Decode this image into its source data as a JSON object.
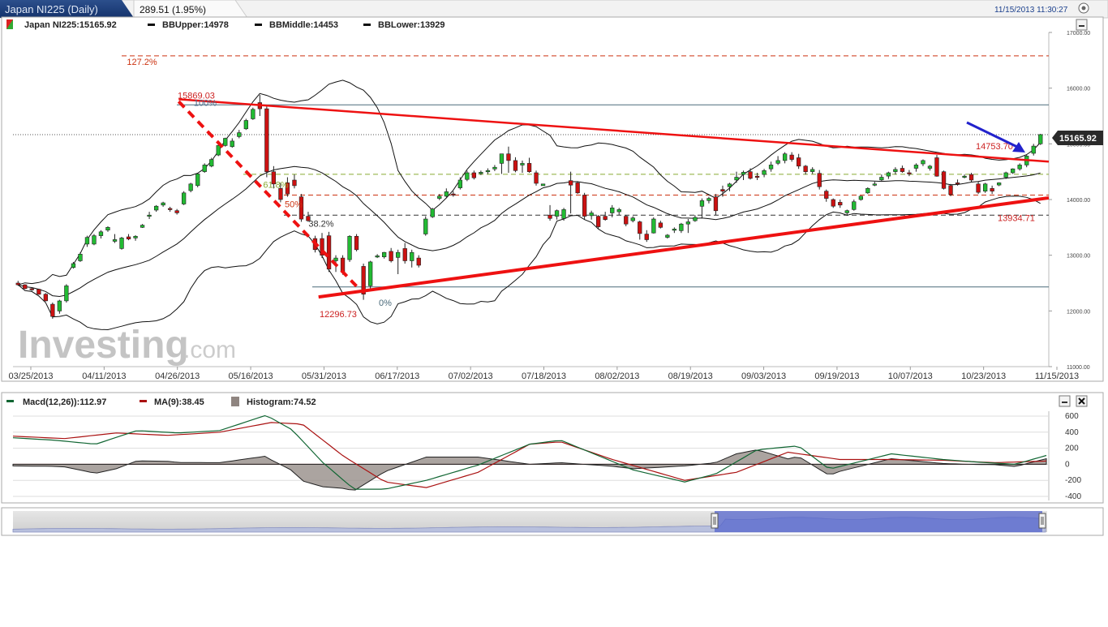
{
  "header": {
    "tab_title": "Japan NI225 (Daily)",
    "change": "289.51 (1.95%)",
    "timestamp": "11/15/2013 11:30:27"
  },
  "legend": {
    "instrument": "Japan NI225:15165.92",
    "bb_upper": "BBUpper:14978",
    "bb_middle": "BBMiddle:14453",
    "bb_lower": "BBLower:13929"
  },
  "watermark": {
    "brand": "Investing",
    "suffix": ".com"
  },
  "macd_legend": {
    "macd": "Macd(12,26)):112.97",
    "ma": "MA(9):38.45",
    "histogram": "Histogram:74.52"
  },
  "colors": {
    "up": "#22bb33",
    "down": "#cc1111",
    "trendline": "#ee1111",
    "fib_line": "#cc3311",
    "arrow": "#2222cc",
    "navigator_fill": "#5566cc",
    "macd_line": "#116633",
    "ma_line": "#aa1111",
    "hist_fill": "#8f8580"
  },
  "chart_data": [
    {
      "type": "candlestick",
      "title": "Japan NI225 (Daily)",
      "x_ticks": [
        "03/25/2013",
        "04/11/2013",
        "04/26/2013",
        "05/16/2013",
        "05/31/2013",
        "06/17/2013",
        "07/02/2013",
        "07/18/2013",
        "08/02/2013",
        "08/19/2013",
        "09/03/2013",
        "09/19/2013",
        "10/07/2013",
        "10/23/2013",
        "11/15/2013"
      ],
      "y_ticks": [
        "17000.00",
        "16000.00",
        "15000.00",
        "14000.00",
        "13000.00",
        "12000.00",
        "11000.00"
      ],
      "ylim": [
        11000,
        17000
      ],
      "last_price_label": "15165.92",
      "annotations": [
        {
          "text": "127.2%",
          "value": 16580
        },
        {
          "text": "15869.03",
          "value": 15869.03
        },
        {
          "text": "100%",
          "value": 15869.03
        },
        {
          "text": "61.8%",
          "value": 14400
        },
        {
          "text": "50%",
          "value": 14050
        },
        {
          "text": "38.2%",
          "value": 13700
        },
        {
          "text": "0%",
          "value": 12296.73
        },
        {
          "text": "12296.73",
          "value": 12296.73
        },
        {
          "text": "14753.70",
          "value": 14753.7
        },
        {
          "text": "13934.71",
          "value": 13934.71
        }
      ],
      "levels": [
        {
          "value": 16580,
          "style": "dashed",
          "color": "#cc3311"
        },
        {
          "value": 15700,
          "style": "solid",
          "color": "#4a6a7a"
        },
        {
          "value": 15165.92,
          "style": "dotted",
          "color": "#555555"
        },
        {
          "value": 14453,
          "style": "dashed",
          "color": "#88aa33"
        },
        {
          "value": 14080,
          "style": "dashed",
          "color": "#cc3311"
        },
        {
          "value": 13720,
          "style": "dashed",
          "color": "#333333"
        },
        {
          "value": 12430,
          "style": "solid",
          "color": "#4a6a7a"
        }
      ],
      "trendlines": [
        {
          "name": "upper",
          "from": [
            0.16,
            15800
          ],
          "to": [
            1.0,
            14680
          ]
        },
        {
          "name": "lower",
          "from": [
            0.295,
            12250
          ],
          "to": [
            1.0,
            14030
          ]
        },
        {
          "name": "retrace",
          "from": [
            0.16,
            15760
          ],
          "to": [
            0.335,
            12380
          ]
        }
      ],
      "candles": [
        [
          12500,
          12540,
          12450,
          12470
        ],
        [
          12470,
          12480,
          12390,
          12400
        ],
        [
          12400,
          12420,
          12360,
          12390
        ],
        [
          12390,
          12400,
          12290,
          12300
        ],
        [
          12300,
          12320,
          12170,
          12180
        ],
        [
          12120,
          12150,
          11860,
          11900
        ],
        [
          12000,
          12200,
          11950,
          12180
        ],
        [
          12180,
          12480,
          12150,
          12450
        ],
        [
          12780,
          12880,
          12760,
          12850
        ],
        [
          12900,
          13050,
          12880,
          13020
        ],
        [
          13200,
          13350,
          13150,
          13320
        ],
        [
          13200,
          13380,
          13180,
          13350
        ],
        [
          13350,
          13450,
          13300,
          13420
        ],
        [
          13450,
          13520,
          13420,
          13500
        ],
        [
          13250,
          13380,
          13220,
          13280
        ],
        [
          13120,
          13330,
          13100,
          13310
        ],
        [
          13330,
          13380,
          13270,
          13290
        ],
        [
          13310,
          13360,
          13260,
          13340
        ],
        [
          13500,
          13560,
          13490,
          13540
        ],
        [
          13700,
          13780,
          13650,
          13720
        ],
        [
          13810,
          13900,
          13780,
          13880
        ],
        [
          13900,
          13960,
          13870,
          13940
        ],
        [
          13840,
          13870,
          13780,
          13820
        ],
        [
          13800,
          13830,
          13730,
          13760
        ],
        [
          13920,
          14150,
          13900,
          14120
        ],
        [
          14160,
          14300,
          14130,
          14280
        ],
        [
          14250,
          14480,
          14220,
          14460
        ],
        [
          14500,
          14650,
          14480,
          14620
        ],
        [
          14600,
          14750,
          14580,
          14720
        ],
        [
          14800,
          15000,
          14780,
          14970
        ],
        [
          14970,
          15110,
          14950,
          15100
        ],
        [
          14950,
          15100,
          14930,
          15050
        ],
        [
          15130,
          15250,
          15100,
          15200
        ],
        [
          15270,
          15450,
          15250,
          15420
        ],
        [
          15450,
          15650,
          15430,
          15620
        ],
        [
          15740,
          15880,
          15500,
          15630
        ],
        [
          15630,
          15700,
          14400,
          14500
        ],
        [
          14500,
          14600,
          14200,
          14280
        ],
        [
          14200,
          14300,
          13950,
          14000
        ],
        [
          14300,
          14400,
          14050,
          14100
        ],
        [
          14350,
          14450,
          14200,
          14250
        ],
        [
          14050,
          14100,
          13600,
          13650
        ],
        [
          13700,
          13780,
          13600,
          13620
        ],
        [
          13300,
          13350,
          13050,
          13100
        ],
        [
          13300,
          13400,
          12950,
          13000
        ],
        [
          13350,
          13420,
          12700,
          12750
        ],
        [
          12900,
          13000,
          12700,
          12950
        ],
        [
          12950,
          13000,
          12650,
          12700
        ],
        [
          12920,
          13360,
          12880,
          13340
        ],
        [
          13340,
          13380,
          13070,
          13100
        ],
        [
          12800,
          12850,
          12200,
          12300
        ],
        [
          12450,
          12900,
          12400,
          12880
        ],
        [
          12980,
          13020,
          12950,
          12990
        ],
        [
          12970,
          13060,
          12940,
          13050
        ],
        [
          13070,
          13130,
          12870,
          12900
        ],
        [
          12960,
          13100,
          12660,
          13050
        ],
        [
          13120,
          13220,
          12850,
          12900
        ],
        [
          12900,
          13100,
          12780,
          13050
        ],
        [
          12950,
          13000,
          12780,
          12820
        ],
        [
          13380,
          13700,
          13350,
          13650
        ],
        [
          13690,
          13850,
          13670,
          13830
        ],
        [
          14020,
          14100,
          13990,
          14060
        ],
        [
          14060,
          14200,
          14040,
          14140
        ],
        [
          14100,
          14150,
          14050,
          14080
        ],
        [
          14210,
          14400,
          14180,
          14350
        ],
        [
          14360,
          14520,
          14330,
          14480
        ],
        [
          14480,
          14520,
          14360,
          14390
        ],
        [
          14470,
          14520,
          14440,
          14490
        ],
        [
          14500,
          14560,
          14460,
          14520
        ],
        [
          14550,
          14620,
          14510,
          14580
        ],
        [
          14650,
          14750,
          14460,
          14820
        ],
        [
          14820,
          14950,
          14480,
          14700
        ],
        [
          14700,
          14760,
          14490,
          14520
        ],
        [
          14620,
          14700,
          14480,
          14650
        ],
        [
          14650,
          14750,
          14480,
          14500
        ],
        [
          14480,
          14520,
          14250,
          14290
        ],
        [
          14250,
          14280,
          14250,
          14280
        ],
        [
          13720,
          13900,
          13620,
          13660
        ],
        [
          13700,
          13820,
          13640,
          13800
        ],
        [
          13660,
          13850,
          13620,
          13820
        ],
        [
          14340,
          14500,
          13750,
          14260
        ],
        [
          14300,
          14320,
          14100,
          14120
        ],
        [
          14080,
          14120,
          13640,
          13700
        ],
        [
          13710,
          13800,
          13640,
          13760
        ],
        [
          13700,
          13720,
          13480,
          13510
        ],
        [
          13700,
          13780,
          13620,
          13640
        ],
        [
          13760,
          13900,
          13680,
          13850
        ],
        [
          13780,
          13850,
          13720,
          13820
        ],
        [
          13700,
          13720,
          13520,
          13560
        ],
        [
          13620,
          13700,
          13590,
          13670
        ],
        [
          13600,
          13620,
          13280,
          13390
        ],
        [
          13380,
          13450,
          13240,
          13280
        ],
        [
          13400,
          13680,
          13390,
          13650
        ],
        [
          13580,
          13620,
          13480,
          13500
        ],
        [
          13320,
          13380,
          13300,
          13360
        ],
        [
          13450,
          13500,
          13400,
          13470
        ],
        [
          13440,
          13580,
          13400,
          13560
        ],
        [
          13560,
          13650,
          13400,
          13600
        ],
        [
          13620,
          13720,
          13600,
          13680
        ],
        [
          13880,
          14020,
          13660,
          13980
        ],
        [
          13980,
          14050,
          13930,
          14020
        ],
        [
          14050,
          14100,
          13720,
          13800
        ],
        [
          14180,
          14250,
          14050,
          14150
        ],
        [
          14230,
          14300,
          14150,
          14280
        ],
        [
          14350,
          14500,
          14300,
          14400
        ],
        [
          14450,
          14520,
          14350,
          14490
        ],
        [
          14500,
          14560,
          14360,
          14380
        ],
        [
          14420,
          14480,
          14350,
          14400
        ],
        [
          14450,
          14550,
          14400,
          14520
        ],
        [
          14550,
          14680,
          14500,
          14620
        ],
        [
          14650,
          14780,
          14620,
          14700
        ],
        [
          14700,
          14850,
          14650,
          14820
        ],
        [
          14800,
          14850,
          14680,
          14720
        ],
        [
          14750,
          14820,
          14550,
          14600
        ],
        [
          14600,
          14620,
          14450,
          14500
        ],
        [
          14500,
          14580,
          14460,
          14540
        ],
        [
          14470,
          14530,
          14180,
          14230
        ],
        [
          14150,
          14180,
          13960,
          14020
        ],
        [
          14000,
          14020,
          13850,
          13880
        ],
        [
          13950,
          14000,
          13850,
          13900
        ],
        [
          13760,
          13820,
          13720,
          13800
        ],
        [
          13820,
          14000,
          13800,
          13960
        ],
        [
          14000,
          14070,
          13980,
          14060
        ],
        [
          14120,
          14220,
          14100,
          14200
        ],
        [
          14280,
          14320,
          14240,
          14280
        ],
        [
          14350,
          14450,
          14320,
          14400
        ],
        [
          14420,
          14500,
          14370,
          14480
        ],
        [
          14500,
          14580,
          14450,
          14540
        ],
        [
          14560,
          14610,
          14480,
          14500
        ],
        [
          14480,
          14530,
          14420,
          14460
        ],
        [
          14560,
          14650,
          14500,
          14620
        ],
        [
          14640,
          14720,
          14600,
          14700
        ],
        [
          14560,
          14620,
          14520,
          14600
        ],
        [
          14750,
          14800,
          14410,
          14420
        ],
        [
          14500,
          14520,
          14180,
          14200
        ],
        [
          14250,
          14280,
          14060,
          14090
        ],
        [
          14300,
          14360,
          14250,
          14280
        ],
        [
          14400,
          14450,
          14380,
          14420
        ],
        [
          14450,
          14480,
          14320,
          14350
        ],
        [
          14280,
          14320,
          14100,
          14130
        ],
        [
          14150,
          14300,
          14120,
          14280
        ],
        [
          14200,
          14250,
          14100,
          14150
        ],
        [
          14260,
          14310,
          14240,
          14300
        ],
        [
          14400,
          14500,
          14370,
          14480
        ],
        [
          14480,
          14560,
          14460,
          14550
        ],
        [
          14550,
          14650,
          14520,
          14620
        ],
        [
          14620,
          14800,
          14580,
          14780
        ],
        [
          14830,
          15000,
          14790,
          14960
        ],
        [
          15000,
          15180,
          14980,
          15165.92
        ]
      ]
    },
    {
      "type": "line+histogram",
      "title": "MACD",
      "y_ticks": [
        "600",
        "400",
        "200",
        "0",
        "-200",
        "-400"
      ],
      "ylim": [
        -430,
        640
      ],
      "series": [
        {
          "name": "Macd(12,26))",
          "x": [
            0,
            0.04,
            0.08,
            0.12,
            0.16,
            0.2,
            0.245,
            0.27,
            0.3,
            0.33,
            0.36,
            0.4,
            0.45,
            0.5,
            0.53,
            0.6,
            0.65,
            0.68,
            0.72,
            0.76,
            0.79,
            0.85,
            0.9,
            0.93,
            0.97,
            1.0
          ],
          "values": [
            330,
            300,
            250,
            420,
            390,
            420,
            610,
            430,
            20,
            -310,
            -310,
            -200,
            -10,
            250,
            300,
            -70,
            -220,
            -120,
            180,
            230,
            -60,
            130,
            60,
            30,
            0,
            110
          ]
        },
        {
          "name": "MA(9)",
          "x": [
            0,
            0.05,
            0.1,
            0.15,
            0.2,
            0.25,
            0.28,
            0.32,
            0.36,
            0.4,
            0.45,
            0.5,
            0.53,
            0.58,
            0.65,
            0.7,
            0.75,
            0.8,
            0.85,
            0.9,
            0.95,
            1.0
          ],
          "values": [
            350,
            320,
            390,
            360,
            400,
            520,
            500,
            100,
            -220,
            -290,
            -100,
            250,
            280,
            60,
            -200,
            -100,
            150,
            60,
            60,
            50,
            20,
            40
          ]
        }
      ]
    }
  ]
}
